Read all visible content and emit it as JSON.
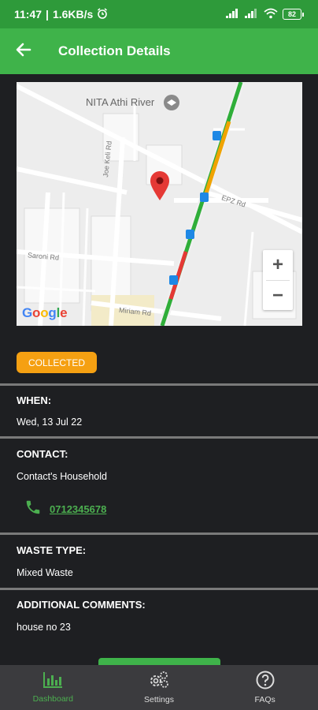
{
  "status": {
    "time": "11:47",
    "speed": "1.6KB/s",
    "battery": "82"
  },
  "header": {
    "title": "Collection Details",
    "back_icon": "arrow-left-icon"
  },
  "map": {
    "place_labels": {
      "nita": "NITA Athi River",
      "joe_keli": "Joe Keli Rd",
      "epz": "EPZ Rd",
      "saroni": "Saroni Rd",
      "miriam": "Miriam Rd"
    },
    "zoom_in": "+",
    "zoom_out": "−",
    "google_logo": "Google"
  },
  "collection": {
    "status_badge": "COLLECTED",
    "badge_color": "#f5a012",
    "when_label": "WHEN:",
    "when_value": "Wed, 13 Jul 22",
    "contact_label": "CONTACT:",
    "contact_name": "Contact's Household",
    "phone": "0712345678",
    "waste_label": "WASTE TYPE:",
    "waste_value": "Mixed Waste",
    "comments_label": "ADDITIONAL COMMENTS:",
    "comments_value": "house no 23"
  },
  "nav": {
    "items": [
      {
        "label": "Dashboard",
        "icon": "bar-chart-icon"
      },
      {
        "label": "Settings",
        "icon": "gears-icon"
      },
      {
        "label": "FAQs",
        "icon": "question-circle-icon"
      }
    ]
  },
  "colors": {
    "appbar": "#3fb34a",
    "statusbar": "#2e9a3a",
    "background": "#1e1f22",
    "accent": "#4caf50"
  }
}
